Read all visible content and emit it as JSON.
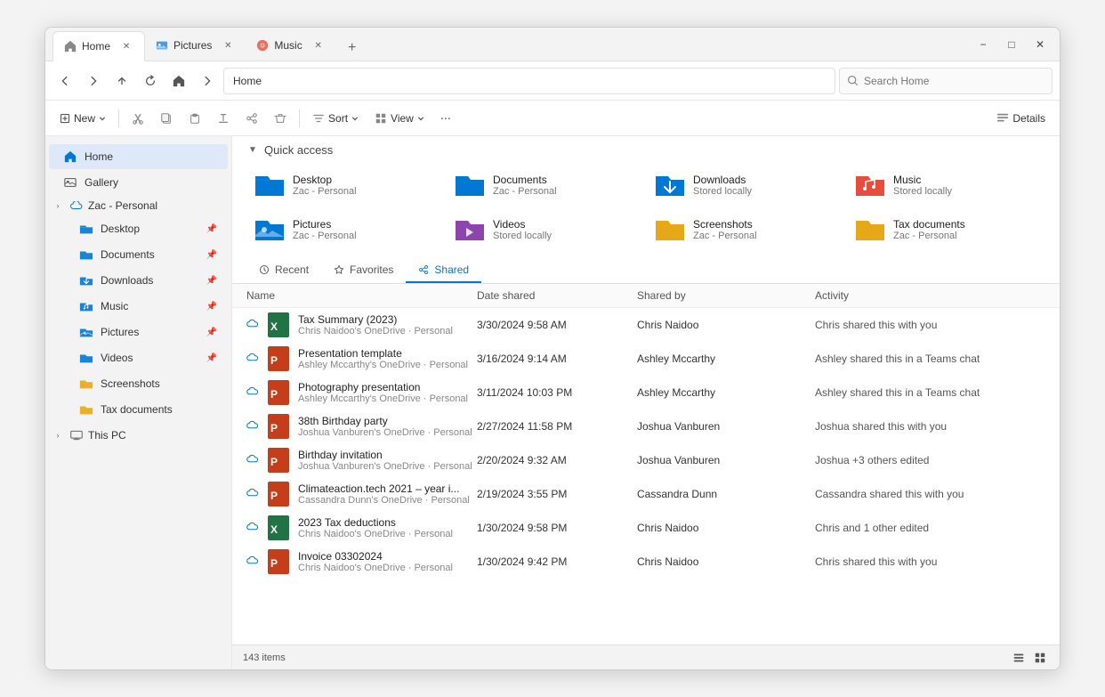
{
  "window": {
    "title": "Home"
  },
  "tabs": [
    {
      "id": "home",
      "label": "Home",
      "icon": "home",
      "active": true
    },
    {
      "id": "pictures",
      "label": "Pictures",
      "icon": "pictures",
      "active": false
    },
    {
      "id": "music",
      "label": "Music",
      "icon": "music",
      "active": false
    }
  ],
  "window_controls": {
    "minimize": "−",
    "maximize": "□",
    "close": "✕"
  },
  "address": {
    "back": "←",
    "forward": "→",
    "up": "↑",
    "refresh": "↻",
    "home": "⌂",
    "next": "›",
    "path": "Home",
    "search_placeholder": "Search Home"
  },
  "toolbar": {
    "new_label": "New",
    "cut_label": "Cut",
    "copy_label": "Copy",
    "paste_label": "Paste",
    "rename_label": "Rename",
    "share_label": "Share",
    "delete_label": "Delete",
    "sort_label": "Sort",
    "view_label": "View",
    "more_label": "⋯",
    "details_label": "Details"
  },
  "sidebar": {
    "items": [
      {
        "id": "home",
        "label": "Home",
        "icon": "home",
        "active": true,
        "pinned": false
      },
      {
        "id": "gallery",
        "label": "Gallery",
        "icon": "gallery",
        "active": false,
        "pinned": false
      },
      {
        "id": "zac-personal",
        "label": "Zac - Personal",
        "icon": "cloud",
        "active": false,
        "pinned": false,
        "expandable": true
      },
      {
        "id": "desktop",
        "label": "Desktop",
        "icon": "desktop-folder",
        "active": false,
        "pinned": true
      },
      {
        "id": "documents",
        "label": "Documents",
        "icon": "documents-folder",
        "active": false,
        "pinned": true
      },
      {
        "id": "downloads",
        "label": "Downloads",
        "icon": "downloads-folder",
        "active": false,
        "pinned": true
      },
      {
        "id": "music",
        "label": "Music",
        "icon": "music-folder",
        "active": false,
        "pinned": true
      },
      {
        "id": "pictures",
        "label": "Pictures",
        "icon": "pictures-folder",
        "active": false,
        "pinned": true
      },
      {
        "id": "videos",
        "label": "Videos",
        "icon": "videos-folder",
        "active": false,
        "pinned": true
      },
      {
        "id": "screenshots",
        "label": "Screenshots",
        "icon": "screenshots-folder",
        "active": false,
        "pinned": false
      },
      {
        "id": "tax-documents",
        "label": "Tax documents",
        "icon": "tax-folder",
        "active": false,
        "pinned": false
      },
      {
        "id": "this-pc",
        "label": "This PC",
        "icon": "pc",
        "active": false,
        "expandable": true
      }
    ]
  },
  "quick_access": {
    "section_label": "Quick access",
    "items": [
      {
        "name": "Desktop",
        "sub": "Zac - Personal",
        "color": "#0078d4",
        "type": "folder",
        "badge": "pin"
      },
      {
        "name": "Documents",
        "sub": "Zac - Personal",
        "color": "#0078d4",
        "type": "folder",
        "badge": "pin"
      },
      {
        "name": "Downloads",
        "sub": "Stored locally",
        "color": "#0078d4",
        "type": "downloads-folder",
        "badge": "pin"
      },
      {
        "name": "Music",
        "sub": "Stored locally",
        "color": "#e74c3c",
        "type": "music-folder",
        "badge": "pin"
      },
      {
        "name": "Pictures",
        "sub": "Zac - Personal",
        "color": "#0078d4",
        "type": "pictures-folder",
        "badge": "pin"
      },
      {
        "name": "Videos",
        "sub": "Stored locally",
        "color": "#8e44ad",
        "type": "videos-folder",
        "badge": "pin"
      },
      {
        "name": "Screenshots",
        "sub": "Zac - Personal",
        "color": "#e6a817",
        "type": "folder",
        "badge": null
      },
      {
        "name": "Tax documents",
        "sub": "Zac - Personal",
        "color": "#e6a817",
        "type": "folder",
        "badge": null
      }
    ]
  },
  "inner_tabs": [
    {
      "id": "recent",
      "label": "Recent",
      "icon": "clock",
      "active": false
    },
    {
      "id": "favorites",
      "label": "Favorites",
      "icon": "star",
      "active": false
    },
    {
      "id": "shared",
      "label": "Shared",
      "icon": "share",
      "active": true
    }
  ],
  "file_list": {
    "headers": [
      "Name",
      "Date shared",
      "Shared by",
      "Activity"
    ],
    "rows": [
      {
        "name": "Tax Summary (2023)",
        "sub": "Chris Naidoo's OneDrive · Personal",
        "date": "3/30/2024 9:58 AM",
        "shared_by": "Chris Naidoo",
        "activity": "Chris shared this with you",
        "icon": "excel"
      },
      {
        "name": "Presentation template",
        "sub": "Ashley Mccarthy's OneDrive · Personal",
        "date": "3/16/2024 9:14 AM",
        "shared_by": "Ashley Mccarthy",
        "activity": "Ashley shared this in a Teams chat",
        "icon": "powerpoint"
      },
      {
        "name": "Photography presentation",
        "sub": "Ashley Mccarthy's OneDrive · Personal",
        "date": "3/11/2024 10:03 PM",
        "shared_by": "Ashley Mccarthy",
        "activity": "Ashley shared this in a Teams chat",
        "icon": "powerpoint"
      },
      {
        "name": "38th Birthday party",
        "sub": "Joshua Vanburen's OneDrive · Personal",
        "date": "2/27/2024 11:58 PM",
        "shared_by": "Joshua Vanburen",
        "activity": "Joshua shared this with you",
        "icon": "powerpoint"
      },
      {
        "name": "Birthday invitation",
        "sub": "Joshua Vanburen's OneDrive · Personal",
        "date": "2/20/2024 9:32 AM",
        "shared_by": "Joshua Vanburen",
        "activity": "Joshua +3 others edited",
        "icon": "powerpoint"
      },
      {
        "name": "Climateaction.tech 2021 – year i...",
        "sub": "Cassandra Dunn's OneDrive · Personal",
        "date": "2/19/2024 3:55 PM",
        "shared_by": "Cassandra Dunn",
        "activity": "Cassandra shared this with you",
        "icon": "powerpoint"
      },
      {
        "name": "2023 Tax deductions",
        "sub": "Chris Naidoo's OneDrive · Personal",
        "date": "1/30/2024 9:58 PM",
        "shared_by": "Chris Naidoo",
        "activity": "Chris and 1 other edited",
        "icon": "excel"
      },
      {
        "name": "Invoice 03302024",
        "sub": "Chris Naidoo's OneDrive · Personal",
        "date": "1/30/2024 9:42 PM",
        "shared_by": "Chris Naidoo",
        "activity": "Chris shared this with you",
        "icon": "powerpoint"
      }
    ]
  },
  "status_bar": {
    "items_count": "143 items"
  }
}
